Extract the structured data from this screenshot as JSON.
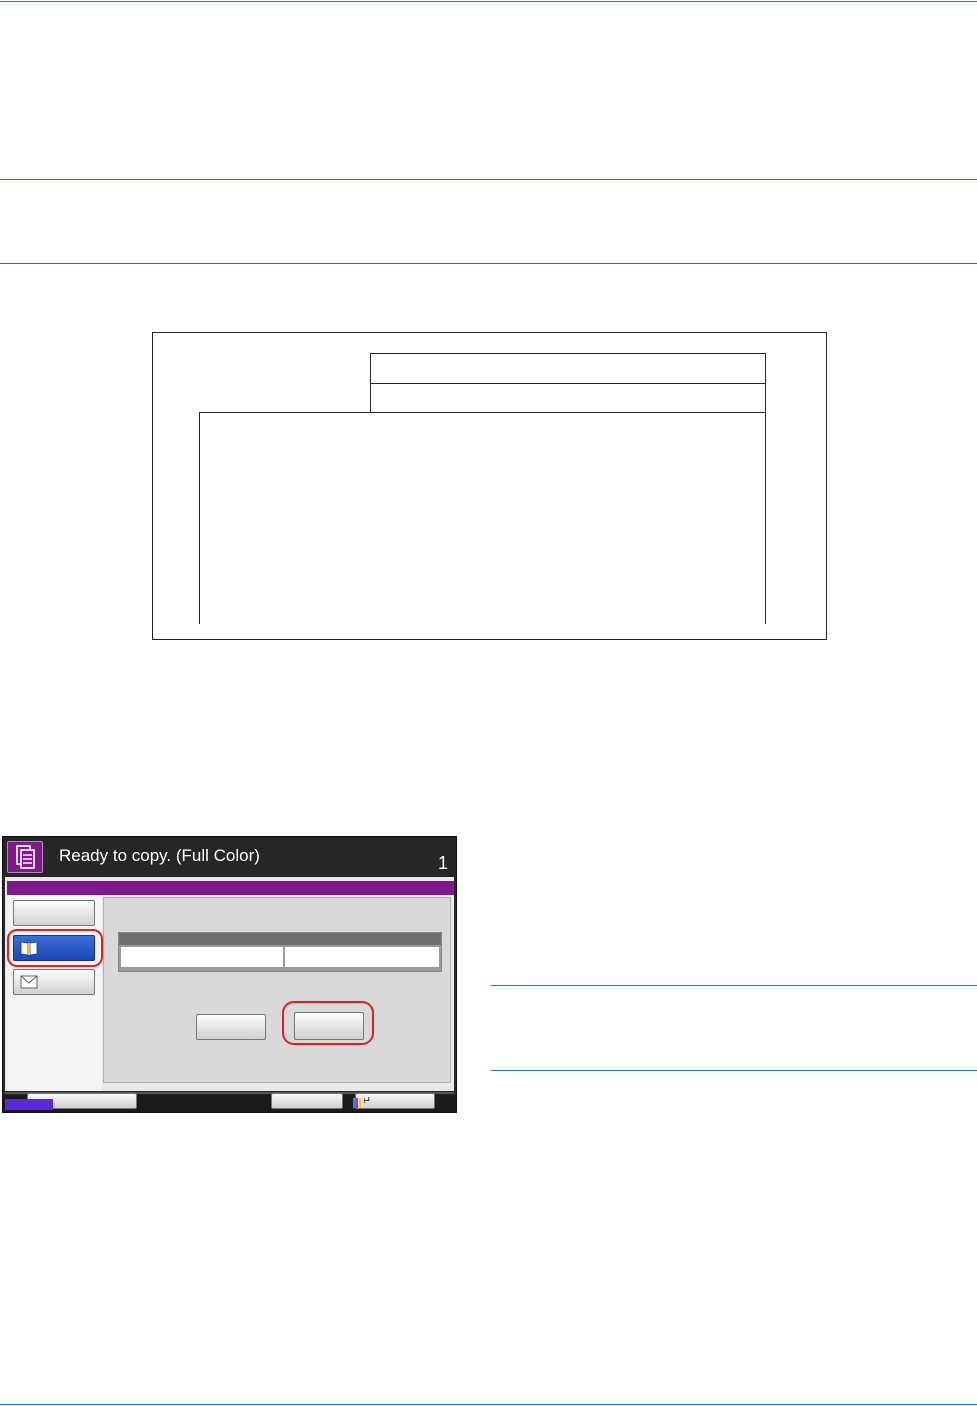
{
  "panel": {
    "status_message": "Ready to copy. (Full Color)",
    "copy_count": "1",
    "enter_glyph": "↵",
    "icons": {
      "header": "copy-icon",
      "address_book": "address-book-icon",
      "email": "envelope-icon",
      "toner": "toner-level-icon"
    },
    "colors": {
      "accent": "#7d1a8b",
      "selected": "#1e48b4",
      "highlight": "#e02020",
      "rule": "#2a6fb4"
    }
  }
}
